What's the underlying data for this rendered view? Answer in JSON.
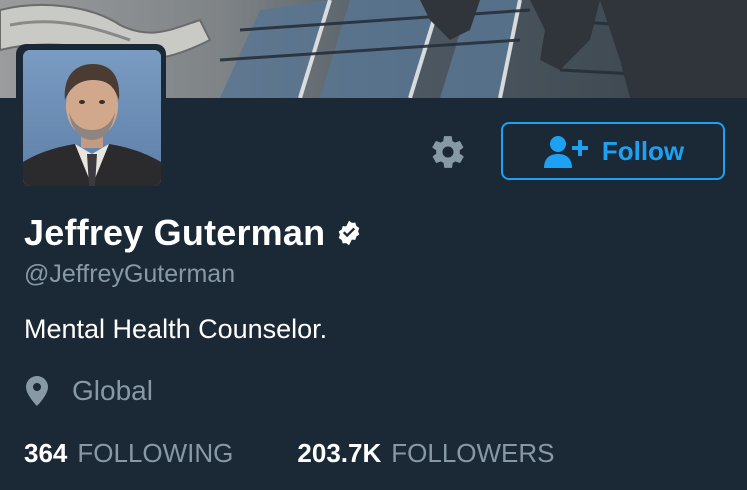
{
  "profile": {
    "name": "Jeffrey Guterman",
    "handle": "@JeffreyGuterman",
    "bio": "Mental Health Counselor.",
    "location": "Global",
    "verified": true
  },
  "actions": {
    "follow_label": "Follow"
  },
  "stats": [
    {
      "count": "364",
      "label": "FOLLOWING"
    },
    {
      "count": "203.7K",
      "label": "FOLLOWERS"
    }
  ],
  "icons": {
    "settings": "gear-icon",
    "follow": "add-user-icon",
    "verified": "verified-badge-icon",
    "location": "location-pin-icon"
  },
  "colors": {
    "background": "#1b2836",
    "accent": "#1da1f2",
    "muted_text": "#8899a6",
    "primary_text": "#ffffff"
  }
}
